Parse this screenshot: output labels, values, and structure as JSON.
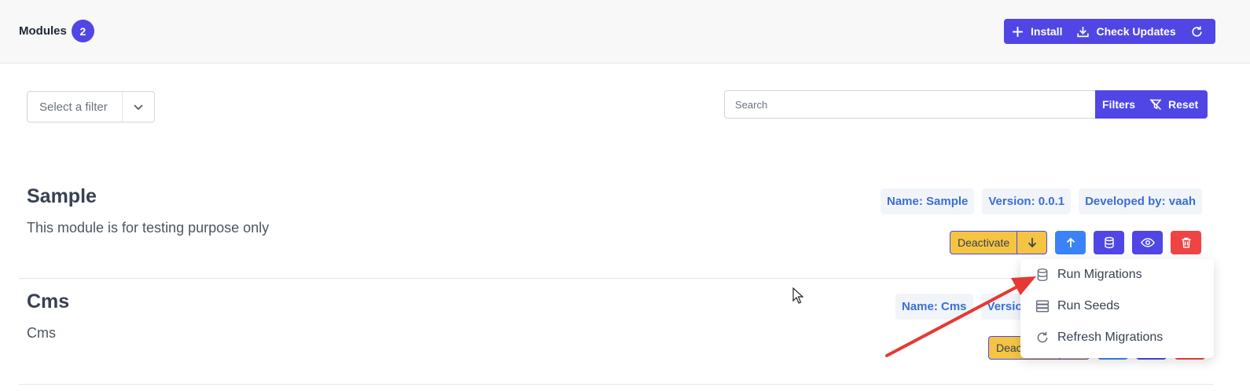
{
  "header": {
    "title": "Modules",
    "count": "2",
    "buttons": {
      "install": "Install",
      "check_updates": "Check Updates"
    }
  },
  "filter": {
    "select_placeholder": "Select a filter"
  },
  "search": {
    "placeholder": "Search",
    "value": "",
    "filters_label": "Filters",
    "reset_label": "Reset"
  },
  "modules": [
    {
      "name": "Sample",
      "description": "This module is for testing purpose only",
      "chips": [
        "Name: Sample",
        "Version: 0.0.1",
        "Developed by: vaah"
      ],
      "deactivate_label": "Deactivate"
    },
    {
      "name": "Cms",
      "description": "Cms",
      "chips": [
        "Name: Cms",
        "Versio"
      ],
      "deactivate_label": "Deac"
    }
  ],
  "dropdown": {
    "items": [
      {
        "label": "Run Migrations",
        "icon": "database-icon"
      },
      {
        "label": "Run Seeds",
        "icon": "server-icon"
      },
      {
        "label": "Refresh Migrations",
        "icon": "refresh-icon"
      }
    ]
  },
  "colors": {
    "primary": "#4f46e5",
    "warning": "#f5c542",
    "info": "#3b82f6",
    "danger": "#ef4444",
    "chip_text": "#3b6fd4",
    "annotation_arrow": "#e53935"
  }
}
